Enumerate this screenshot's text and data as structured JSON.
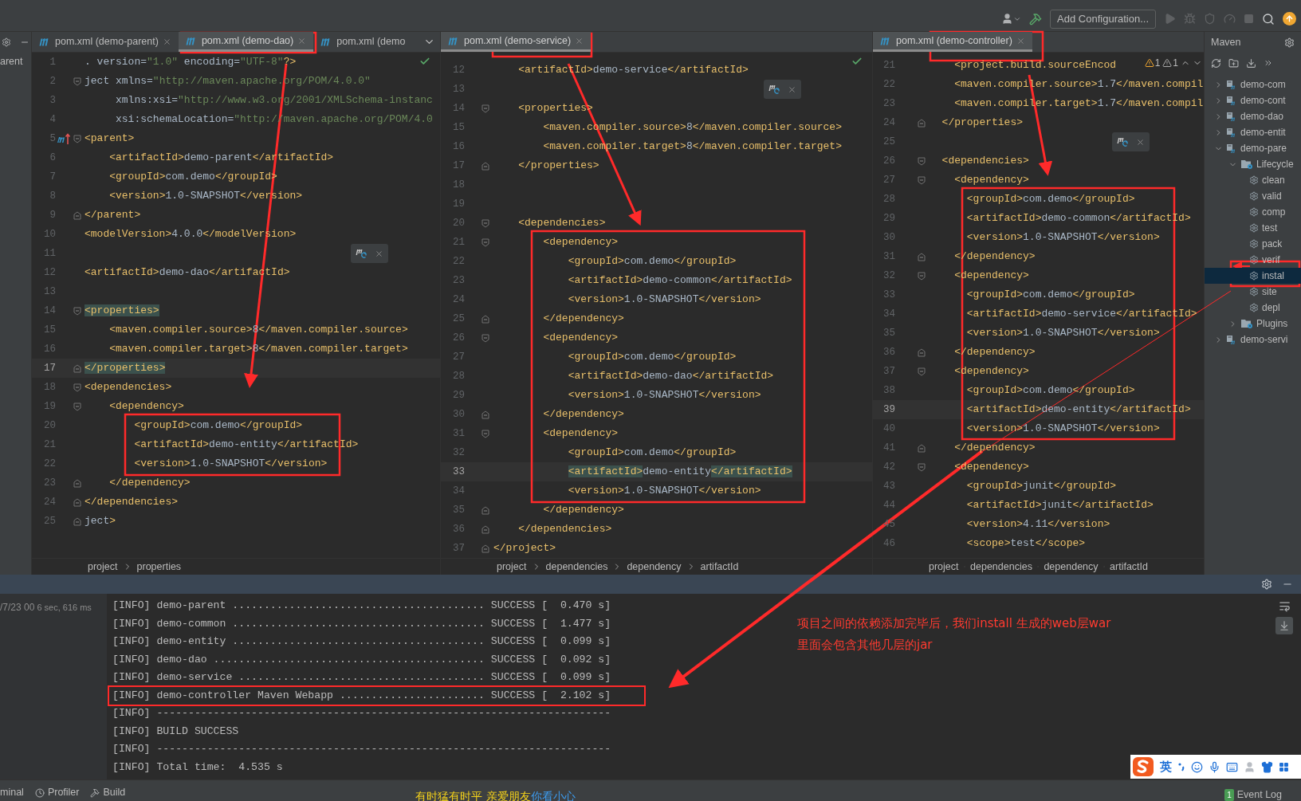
{
  "toolbar": {
    "config_button": "Add Configuration..."
  },
  "side_strip": {
    "label": "arent"
  },
  "panes": [
    {
      "tabs": [
        {
          "title": "pom.xml (demo-parent)",
          "selected": false,
          "closable": true
        },
        {
          "title": "pom.xml (demo-dao)",
          "selected": true,
          "closable": true
        },
        {
          "title": "pom.xml (demo",
          "selected": false
        }
      ],
      "tab_overflow": true,
      "inspection_ok": true,
      "reload_popup": true,
      "lines": [
        {
          "n": "1",
          "code": ". version=\"1.0\" encoding=\"UTF-8\"?>",
          "current": false
        },
        {
          "n": "2",
          "code": "ject xmlns=\"http://maven.apache.org/POM/4.0.0\"",
          "fold_start": true,
          "current": false
        },
        {
          "n": "3",
          "code": "     xmlns:xsi=\"http://www.w3.org/2001/XMLSchema-instanc",
          "current": false
        },
        {
          "n": "4",
          "code": "     xsi:schemaLocation=\"http://maven.apache.org/POM/4.0",
          "current": false
        },
        {
          "n": "5",
          "code": "<parent>",
          "fold_start": true,
          "maven_marker": true,
          "current": false
        },
        {
          "n": "6",
          "code": "    <artifactId>demo-parent</artifactId>",
          "current": false
        },
        {
          "n": "7",
          "code": "    <groupId>com.demo</groupId>",
          "current": false
        },
        {
          "n": "8",
          "code": "    <version>1.0-SNAPSHOT</version>",
          "current": false
        },
        {
          "n": "9",
          "code": "</parent>",
          "fold_end": true,
          "current": false
        },
        {
          "n": "10",
          "code": "<modelVersion>4.0.0</modelVersion>",
          "current": false
        },
        {
          "n": "11",
          "current": false
        },
        {
          "n": "12",
          "code": "<artifactId>demo-dao</artifactId>",
          "current": false
        },
        {
          "n": "13",
          "current": false
        },
        {
          "n": "14",
          "code": "<properties>",
          "fold_start": true,
          "current": false,
          "match": true
        },
        {
          "n": "15",
          "code": "    <maven.compiler.source>8</maven.compiler.source>",
          "current": false
        },
        {
          "n": "16",
          "code": "    <maven.compiler.target>8</maven.compiler.target>",
          "current": false
        },
        {
          "n": "17",
          "code": "</properties>",
          "fold_end": true,
          "current": true,
          "match": true
        },
        {
          "n": "18",
          "code": "<dependencies>",
          "fold_start": true,
          "current": false
        },
        {
          "n": "19",
          "code": "    <dependency>",
          "fold_start": true,
          "current": false
        },
        {
          "n": "20",
          "code": "        <groupId>com.demo</groupId>",
          "current": false
        },
        {
          "n": "21",
          "code": "        <artifactId>demo-entity</artifactId>",
          "current": false
        },
        {
          "n": "22",
          "code": "        <version>1.0-SNAPSHOT</version>",
          "current": false
        },
        {
          "n": "23",
          "code": "    </dependency>",
          "fold_end": true,
          "current": false
        },
        {
          "n": "24",
          "code": "</dependencies>",
          "fold_end": true,
          "current": false
        },
        {
          "n": "25",
          "code": "ject>",
          "fold_end": true,
          "current": false
        }
      ],
      "breadcrumbs": [
        "project",
        "properties"
      ]
    },
    {
      "tabs": [
        {
          "title": "pom.xml (demo-service)",
          "selected": true,
          "closable": true
        }
      ],
      "inspection_ok": true,
      "reload_popup": true,
      "lines": [
        {
          "n": "12",
          "code": "    <artifactId>demo-service</artifactId>",
          "current": false
        },
        {
          "n": "13",
          "current": false
        },
        {
          "n": "14",
          "code": "    <properties>",
          "fold_start": true,
          "current": false
        },
        {
          "n": "15",
          "code": "        <maven.compiler.source>8</maven.compiler.source>",
          "current": false
        },
        {
          "n": "16",
          "code": "        <maven.compiler.target>8</maven.compiler.target>",
          "current": false
        },
        {
          "n": "17",
          "code": "    </properties>",
          "fold_end": true,
          "current": false
        },
        {
          "n": "18",
          "current": false
        },
        {
          "n": "19",
          "current": false
        },
        {
          "n": "20",
          "code": "    <dependencies>",
          "fold_start": true,
          "current": false
        },
        {
          "n": "21",
          "code": "        <dependency>",
          "fold_start": true,
          "current": false
        },
        {
          "n": "22",
          "code": "            <groupId>com.demo</groupId>",
          "current": false
        },
        {
          "n": "23",
          "code": "            <artifactId>demo-common</artifactId>",
          "current": false
        },
        {
          "n": "24",
          "code": "            <version>1.0-SNAPSHOT</version>",
          "current": false
        },
        {
          "n": "25",
          "code": "        </dependency>",
          "fold_end": true,
          "current": false
        },
        {
          "n": "26",
          "code": "        <dependency>",
          "fold_start": true,
          "current": false
        },
        {
          "n": "27",
          "code": "            <groupId>com.demo</groupId>",
          "current": false
        },
        {
          "n": "28",
          "code": "            <artifactId>demo-dao</artifactId>",
          "current": false
        },
        {
          "n": "29",
          "code": "            <version>1.0-SNAPSHOT</version>",
          "current": false
        },
        {
          "n": "30",
          "code": "        </dependency>",
          "fold_end": true,
          "current": false
        },
        {
          "n": "31",
          "code": "        <dependency>",
          "fold_start": true,
          "current": false
        },
        {
          "n": "32",
          "code": "            <groupId>com.demo</groupId>",
          "current": false
        },
        {
          "n": "33",
          "code": "            <artifactId>demo-entity</artifactId>",
          "current": true,
          "match": true
        },
        {
          "n": "34",
          "code": "            <version>1.0-SNAPSHOT</version>",
          "current": false
        },
        {
          "n": "35",
          "code": "        </dependency>",
          "fold_end": true,
          "current": false
        },
        {
          "n": "36",
          "code": "    </dependencies>",
          "fold_end": true,
          "current": false
        },
        {
          "n": "37",
          "code": "</project>",
          "fold_end": true,
          "current": false
        }
      ],
      "breadcrumbs": [
        "project",
        "dependencies",
        "dependency",
        "artifactId"
      ]
    },
    {
      "tabs": [
        {
          "title": "pom.xml (demo-controller)",
          "selected": true,
          "closable": true
        }
      ],
      "reload_popup": true,
      "warnings": [
        "1",
        "1"
      ],
      "lines": [
        {
          "n": "21",
          "code": "    <project.build.sourceEncod",
          "current": false
        },
        {
          "n": "22",
          "code": "    <maven.compiler.source>1.7</maven.compil",
          "current": false
        },
        {
          "n": "23",
          "code": "    <maven.compiler.target>1.7</maven.compil",
          "current": false
        },
        {
          "n": "24",
          "code": "  </properties>",
          "fold_end": true,
          "current": false
        },
        {
          "n": "25",
          "current": false
        },
        {
          "n": "26",
          "code": "  <dependencies>",
          "fold_start": true,
          "current": false
        },
        {
          "n": "27",
          "code": "    <dependency>",
          "fold_start": true,
          "current": false
        },
        {
          "n": "28",
          "code": "      <groupId>com.demo</groupId>",
          "current": false
        },
        {
          "n": "29",
          "code": "      <artifactId>demo-common</artifactId>",
          "current": false
        },
        {
          "n": "30",
          "code": "      <version>1.0-SNAPSHOT</version>",
          "current": false
        },
        {
          "n": "31",
          "code": "    </dependency>",
          "fold_end": true,
          "current": false
        },
        {
          "n": "32",
          "code": "    <dependency>",
          "fold_start": true,
          "current": false
        },
        {
          "n": "33",
          "code": "      <groupId>com.demo</groupId>",
          "current": false
        },
        {
          "n": "34",
          "code": "      <artifactId>demo-service</artifactId>",
          "current": false
        },
        {
          "n": "35",
          "code": "      <version>1.0-SNAPSHOT</version>",
          "current": false
        },
        {
          "n": "36",
          "code": "    </dependency>",
          "fold_end": true,
          "current": false
        },
        {
          "n": "37",
          "code": "    <dependency>",
          "fold_start": true,
          "current": false
        },
        {
          "n": "38",
          "code": "      <groupId>com.demo</groupId>",
          "current": false
        },
        {
          "n": "39",
          "code": "      <artifactId>demo-entity</artifactId>",
          "current": true
        },
        {
          "n": "40",
          "code": "      <version>1.0-SNAPSHOT</version>",
          "current": false
        },
        {
          "n": "41",
          "code": "    </dependency>",
          "fold_end": true,
          "current": false
        },
        {
          "n": "42",
          "code": "    <dependency>",
          "fold_start": true,
          "current": false
        },
        {
          "n": "43",
          "code": "      <groupId>junit</groupId>",
          "current": false
        },
        {
          "n": "44",
          "code": "      <artifactId>junit</artifactId>",
          "current": false
        },
        {
          "n": "45",
          "code": "      <version>4.11</version>",
          "current": false
        },
        {
          "n": "46",
          "code": "      <scope>test</scope>",
          "current": false
        }
      ],
      "breadcrumbs": [
        "project",
        "dependencies",
        "dependency",
        "artifactId"
      ]
    }
  ],
  "maven": {
    "title": "Maven",
    "tree": [
      {
        "label": "demo-com",
        "kind": "module",
        "expanded": false
      },
      {
        "label": "demo-cont",
        "kind": "module",
        "expanded": false
      },
      {
        "label": "demo-dao",
        "kind": "module",
        "expanded": false
      },
      {
        "label": "demo-entit",
        "kind": "module",
        "expanded": false
      },
      {
        "label": "demo-pare",
        "kind": "module",
        "expanded": true,
        "children": [
          {
            "label": "Lifecycle",
            "kind": "folder",
            "expanded": true,
            "children": [
              {
                "label": "clean",
                "kind": "goal",
                "selected": false
              },
              {
                "label": "valid",
                "kind": "goal",
                "selected": false
              },
              {
                "label": "comp",
                "kind": "goal",
                "selected": false
              },
              {
                "label": "test",
                "kind": "goal",
                "selected": false
              },
              {
                "label": "pack",
                "kind": "goal",
                "selected": false
              },
              {
                "label": "verif",
                "kind": "goal",
                "selected": false
              },
              {
                "label": "instal",
                "kind": "goal",
                "selected": true
              },
              {
                "label": "site",
                "kind": "goal",
                "selected": false
              },
              {
                "label": "depl",
                "kind": "goal",
                "selected": false
              }
            ]
          },
          {
            "label": "Plugins",
            "kind": "folder",
            "expanded": false
          }
        ]
      },
      {
        "label": "demo-servi",
        "kind": "module",
        "expanded": false
      }
    ]
  },
  "run_panel": {
    "session": "/7/23 00",
    "duration": "6 sec, 616 ms",
    "console": [
      "[INFO] demo-parent ........................................ SUCCESS [  0.470 s]",
      "[INFO] demo-common ........................................ SUCCESS [  1.477 s]",
      "[INFO] demo-entity ........................................ SUCCESS [  0.099 s]",
      "[INFO] demo-dao ........................................... SUCCESS [  0.092 s]",
      "[INFO] demo-service ....................................... SUCCESS [  0.099 s]",
      "[INFO] demo-controller Maven Webapp ....................... SUCCESS [  2.102 s]",
      "[INFO] ------------------------------------------------------------------------",
      "[INFO] BUILD SUCCESS",
      "[INFO] ------------------------------------------------------------------------",
      "[INFO] Total time:  4.535 s"
    ]
  },
  "annotation": [
    "项目之间的依赖添加完毕后，我们install 生成的web层war",
    "里面会包含其他几层的jar"
  ],
  "status_bar": {
    "items": [
      {
        "label": "minal",
        "kind": "terminal"
      },
      {
        "label": "Profiler",
        "kind": "profiler"
      },
      {
        "label": "Build",
        "kind": "build"
      }
    ],
    "lyrics": [
      {
        "text": "有时猛有时平 亲爱朋友",
        "color": "#f5d21a"
      },
      {
        "text": "你看小心",
        "color": "#3d9cf0"
      }
    ],
    "event_log": {
      "label": "Event Log",
      "count": "1"
    }
  },
  "ime": {
    "mode": "英"
  }
}
